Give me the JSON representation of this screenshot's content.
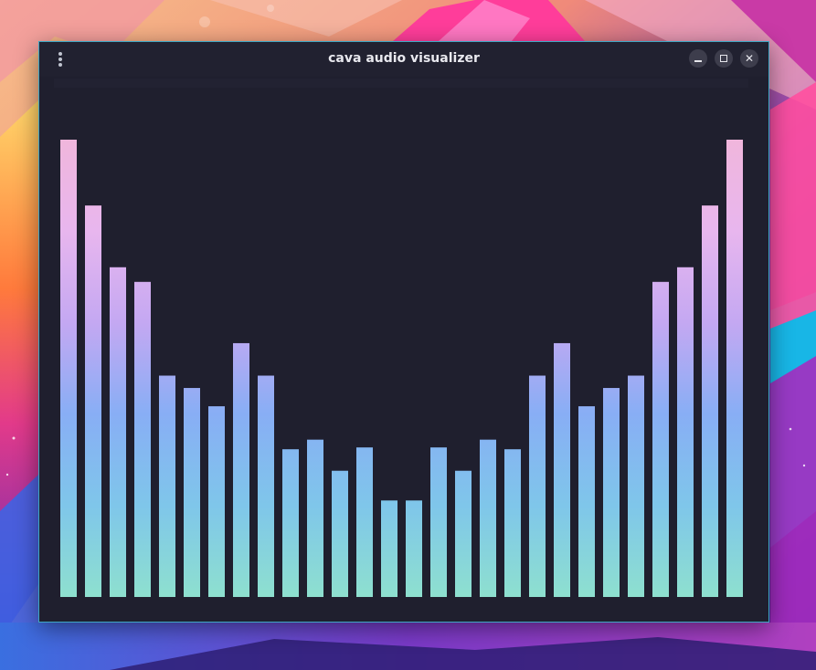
{
  "window": {
    "title": "cava audio visualizer",
    "menu_icon": "kebab-menu-icon",
    "controls": [
      {
        "name": "minimize",
        "icon": "minimize-icon"
      },
      {
        "name": "maximize",
        "icon": "maximize-icon"
      },
      {
        "name": "close",
        "icon": "close-icon",
        "glyph": "✕"
      }
    ]
  },
  "visualizer": {
    "bar_levels": [
      1.0,
      0.856,
      0.721,
      0.689,
      0.484,
      0.457,
      0.417,
      0.555,
      0.484,
      0.323,
      0.344,
      0.276,
      0.327,
      0.211,
      0.211,
      0.327,
      0.276,
      0.344,
      0.323,
      0.484,
      0.555,
      0.417,
      0.457,
      0.484,
      0.689,
      0.721,
      0.856,
      1.0
    ],
    "gradient": [
      "#8ee0cf",
      "#7fc6ea",
      "#88aef5",
      "#c4a8f2",
      "#e8b6ee",
      "#f0b6dc"
    ]
  },
  "colors": {
    "window_bg": "#1f1f2e",
    "titlebar_bg": "#212130",
    "border_accent": "#3fa7c4",
    "title_text": "#e8e8ee"
  }
}
